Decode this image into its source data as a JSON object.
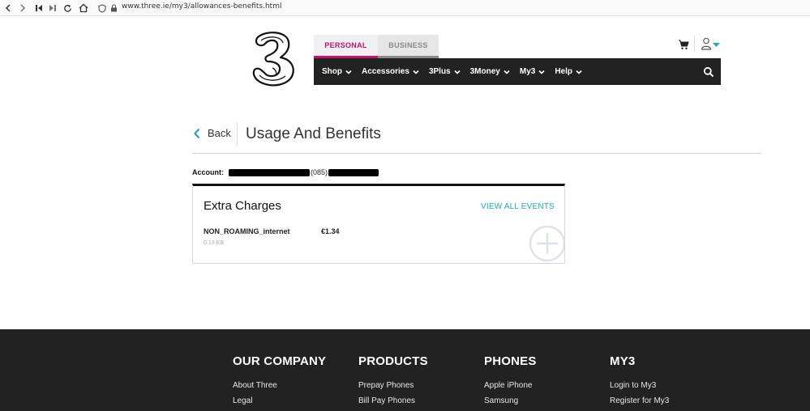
{
  "browser": {
    "url": "www.three.ie/my3/allowances-benefits.html"
  },
  "header": {
    "segments": [
      "PERSONAL",
      "BUSINESS"
    ],
    "nav": [
      {
        "label": "Shop"
      },
      {
        "label": "Accessories"
      },
      {
        "label": "3Plus"
      },
      {
        "label": "3Money"
      },
      {
        "label": "My3"
      },
      {
        "label": "Help"
      }
    ],
    "icons": {
      "logo": "three-logo",
      "cart": "cart-icon",
      "user": "user-icon",
      "search": "search-icon"
    }
  },
  "page": {
    "back_label": "Back",
    "title": "Usage And Benefits",
    "account_label": "Account:",
    "account_fragment": "085"
  },
  "card": {
    "title": "Extra Charges",
    "view_all": "VIEW ALL EVENTS",
    "charge_name": "NON_ROAMING_internet",
    "charge_amount": "€1.34",
    "charge_size": "0.13 KB"
  },
  "footer": {
    "columns": [
      {
        "heading": "OUR COMPANY",
        "links": [
          "About Three",
          "Legal"
        ]
      },
      {
        "heading": "PRODUCTS",
        "links": [
          "Prepay Phones",
          "Bill Pay Phones"
        ]
      },
      {
        "heading": "PHONES",
        "links": [
          "Apple iPhone",
          "Samsung"
        ]
      },
      {
        "heading": "MY3",
        "links": [
          "Login to My3",
          "Register for My3"
        ]
      }
    ]
  },
  "colors": {
    "accent_pink": "#c4136d",
    "accent_teal": "#1aa9bd",
    "nav_bg": "#222222",
    "footer_bg": "#222222"
  }
}
